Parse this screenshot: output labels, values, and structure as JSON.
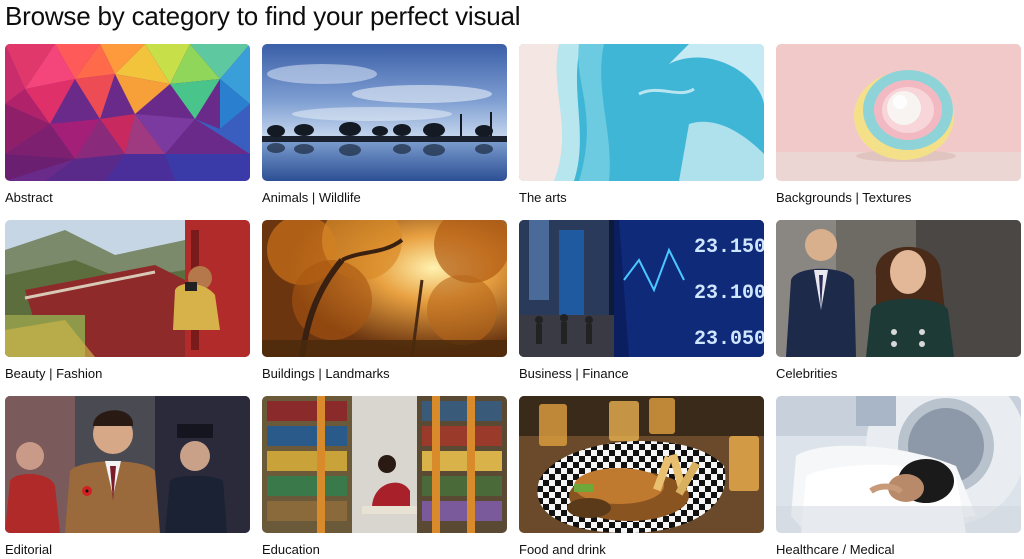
{
  "heading": "Browse by category to find your perfect visual",
  "categories": [
    {
      "label": "Abstract",
      "image": "abstract-polygon-image"
    },
    {
      "label": "Animals | Wildlife",
      "image": "elephants-at-sunset-image"
    },
    {
      "label": "The arts",
      "image": "aerial-ocean-beach-image"
    },
    {
      "label": "Backgrounds | Textures",
      "image": "pastel-sphere-sculpture-image"
    },
    {
      "label": "Beauty | Fashion",
      "image": "woman-photographing-from-train-image"
    },
    {
      "label": "Buildings | Landmarks",
      "image": "autumn-forest-sunlight-image"
    },
    {
      "label": "Business | Finance",
      "image": "stock-ticker-street-image"
    },
    {
      "label": "Celebrities",
      "image": "royal-couple-image"
    },
    {
      "label": "Editorial",
      "image": "politician-with-poppy-image"
    },
    {
      "label": "Education",
      "image": "library-bookshelves-image"
    },
    {
      "label": "Food and drink",
      "image": "burger-and-beer-image"
    },
    {
      "label": "Healthcare / Medical",
      "image": "patient-in-scanner-image"
    }
  ],
  "stock_ticker_numbers": [
    "23.150",
    "23.100",
    "23.050"
  ]
}
